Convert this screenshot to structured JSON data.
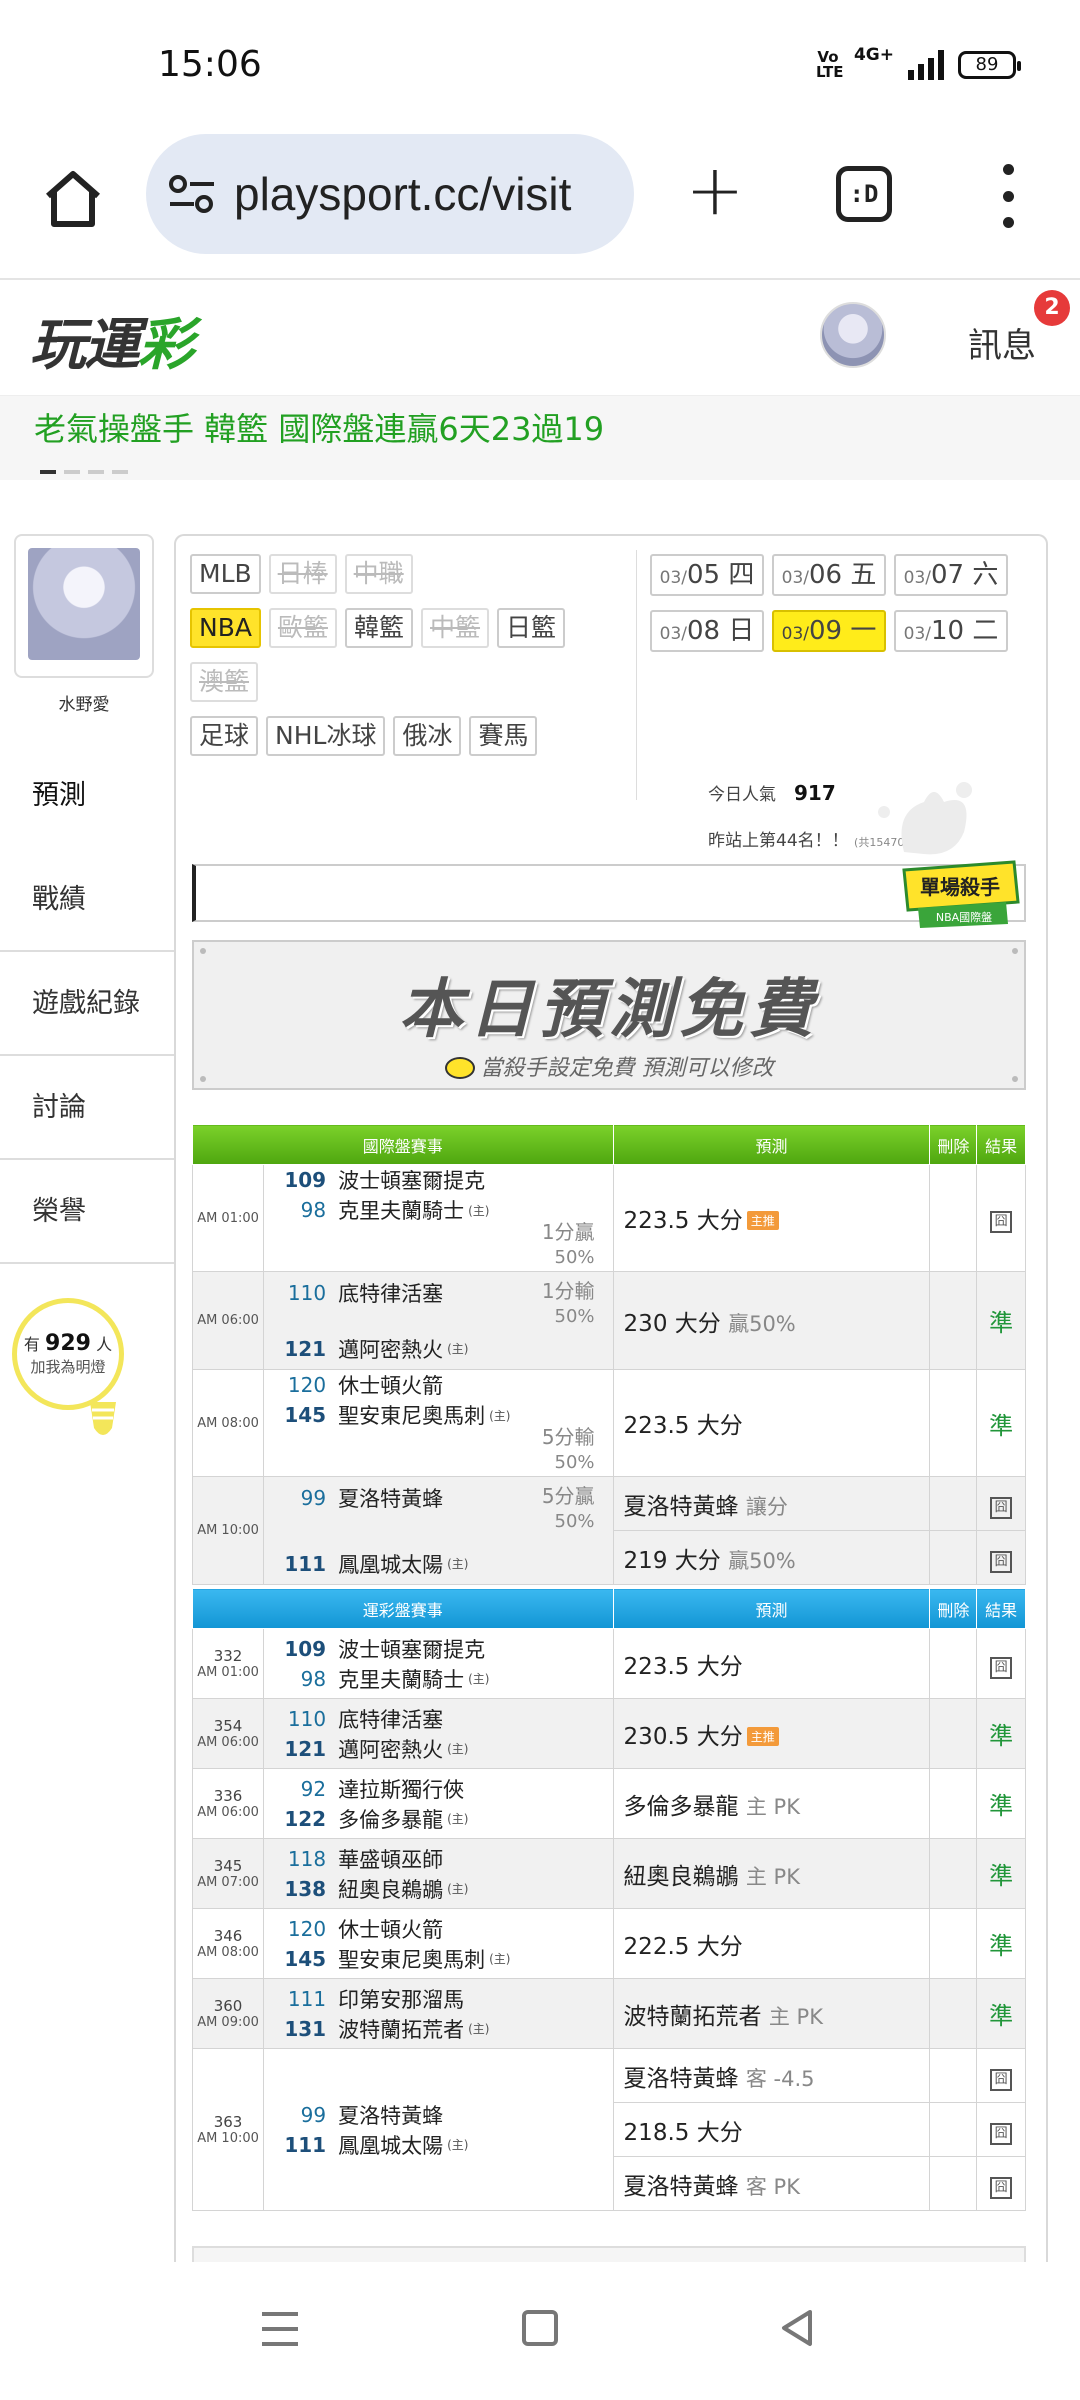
{
  "status": {
    "time": "15:06",
    "volte": "Vo\nLTE",
    "network": "4G+",
    "battery": "89"
  },
  "browser": {
    "url": "playsport.cc/visit",
    "tabs_label": ":D"
  },
  "header": {
    "logo_a": "玩運",
    "logo_b": "彩",
    "messages": "訊息",
    "messages_badge": "2"
  },
  "marquee": {
    "text": "老氣操盤手 韓籃 國際盤連贏6天23過19"
  },
  "profile": {
    "name": "水野愛"
  },
  "sidenav": [
    "預測",
    "戰績",
    "遊戲紀錄",
    "討論",
    "榮譽"
  ],
  "fans": {
    "prefix": "有",
    "count": "929",
    "suffix": "人",
    "cta": "加我為明燈"
  },
  "filters": {
    "row1": [
      {
        "label": "MLB",
        "state": "normal"
      },
      {
        "label": "日棒",
        "state": "disabled"
      },
      {
        "label": "中職",
        "state": "disabled"
      }
    ],
    "row2": [
      {
        "label": "NBA",
        "state": "selected"
      },
      {
        "label": "歐籃",
        "state": "disabled"
      },
      {
        "label": "韓籃",
        "state": "normal"
      },
      {
        "label": "中籃",
        "state": "disabled"
      },
      {
        "label": "日籃",
        "state": "normal"
      }
    ],
    "row3": [
      {
        "label": "澳籃",
        "state": "disabled"
      }
    ],
    "row4": [
      {
        "label": "足球",
        "state": "normal"
      },
      {
        "label": "NHL冰球",
        "state": "normal"
      },
      {
        "label": "俄冰",
        "state": "normal"
      },
      {
        "label": "賽馬",
        "state": "normal"
      }
    ]
  },
  "dates": [
    {
      "m": "03/",
      "d": "05 四",
      "sel": false
    },
    {
      "m": "03/",
      "d": "06 五",
      "sel": false
    },
    {
      "m": "03/",
      "d": "07 六",
      "sel": false
    },
    {
      "m": "03/",
      "d": "08 日",
      "sel": false
    },
    {
      "m": "03/",
      "d": "09 一",
      "sel": true
    },
    {
      "m": "03/",
      "d": "10 二",
      "sel": false
    }
  ],
  "popularity": {
    "label": "今日人氣",
    "value": "917",
    "rank": "昨站上第44名！！",
    "rank_note": "(共15470人)"
  },
  "badge": {
    "title": "單場殺手",
    "sub": "NBA國際盤"
  },
  "banner": {
    "title": "本日預測免費",
    "subtitle": "當殺手設定免費  預測可以修改"
  },
  "intl_table": {
    "headers": [
      "國際盤賽事",
      "預測",
      "刪除",
      "結果"
    ],
    "games": [
      {
        "time": "AM 01:00",
        "teams": [
          {
            "num": "109",
            "name": "波士頓塞爾提克",
            "host": false,
            "bold": true
          },
          {
            "num": "98",
            "name": "克里夫蘭騎士",
            "host": true,
            "bold": false
          }
        ],
        "spread": [
          "1分贏",
          "50%"
        ],
        "spread_pos": "bottom",
        "alt": false,
        "preds": [
          {
            "text": "223.5 大分",
            "sub": "",
            "tag": "主推",
            "result": "box"
          }
        ]
      },
      {
        "time": "AM 06:00",
        "teams": [
          {
            "num": "110",
            "name": "底特律活塞",
            "host": false,
            "bold": false
          },
          {
            "num": "121",
            "name": "邁阿密熱火",
            "host": true,
            "bold": true
          }
        ],
        "spread": [
          "1分輸",
          "50%"
        ],
        "spread_pos": "top",
        "alt": true,
        "preds": [
          {
            "text": "230 大分",
            "sub": "贏50%",
            "tag": "",
            "result": "準"
          }
        ]
      },
      {
        "time": "AM 08:00",
        "teams": [
          {
            "num": "120",
            "name": "休士頓火箭",
            "host": false,
            "bold": false
          },
          {
            "num": "145",
            "name": "聖安東尼奧馬刺",
            "host": true,
            "bold": true
          }
        ],
        "spread": [
          "5分輸",
          "50%"
        ],
        "spread_pos": "bottom",
        "alt": false,
        "preds": [
          {
            "text": "223.5 大分",
            "sub": "",
            "tag": "",
            "result": "準"
          }
        ]
      },
      {
        "time": "AM 10:00",
        "teams": [
          {
            "num": "99",
            "name": "夏洛特黃蜂",
            "host": false,
            "bold": false
          },
          {
            "num": "111",
            "name": "鳳凰城太陽",
            "host": true,
            "bold": true
          }
        ],
        "spread": [
          "5分贏",
          "50%"
        ],
        "spread_pos": "top",
        "alt": true,
        "preds": [
          {
            "text": "夏洛特黃蜂",
            "sub": "讓分",
            "tag": "",
            "result": "box"
          },
          {
            "text": "219 大分",
            "sub": "贏50%",
            "tag": "",
            "result": "box"
          }
        ]
      }
    ]
  },
  "lottery_table": {
    "headers": [
      "運彩盤賽事",
      "預測",
      "刪除",
      "結果"
    ],
    "games": [
      {
        "gid": "332",
        "time": "AM 01:00",
        "teams": [
          {
            "num": "109",
            "name": "波士頓塞爾提克",
            "host": false,
            "bold": true
          },
          {
            "num": "98",
            "name": "克里夫蘭騎士",
            "host": true,
            "bold": false
          }
        ],
        "alt": false,
        "preds": [
          {
            "text": "223.5 大分",
            "sub": "",
            "tag": "",
            "result": "box"
          }
        ]
      },
      {
        "gid": "354",
        "time": "AM 06:00",
        "teams": [
          {
            "num": "110",
            "name": "底特律活塞",
            "host": false,
            "bold": false
          },
          {
            "num": "121",
            "name": "邁阿密熱火",
            "host": true,
            "bold": true
          }
        ],
        "alt": true,
        "preds": [
          {
            "text": "230.5 大分",
            "sub": "",
            "tag": "主推",
            "result": "準"
          }
        ]
      },
      {
        "gid": "336",
        "time": "AM 06:00",
        "teams": [
          {
            "num": "92",
            "name": "達拉斯獨行俠",
            "host": false,
            "bold": false
          },
          {
            "num": "122",
            "name": "多倫多暴龍",
            "host": true,
            "bold": true
          }
        ],
        "alt": false,
        "preds": [
          {
            "text": "多倫多暴龍",
            "sub": "主 PK",
            "tag": "",
            "result": "準"
          }
        ]
      },
      {
        "gid": "345",
        "time": "AM 07:00",
        "teams": [
          {
            "num": "118",
            "name": "華盛頓巫師",
            "host": false,
            "bold": false
          },
          {
            "num": "138",
            "name": "紐奧良鵜鶘",
            "host": true,
            "bold": true
          }
        ],
        "alt": true,
        "preds": [
          {
            "text": "紐奧良鵜鶘",
            "sub": "主 PK",
            "tag": "",
            "result": "準"
          }
        ]
      },
      {
        "gid": "346",
        "time": "AM 08:00",
        "teams": [
          {
            "num": "120",
            "name": "休士頓火箭",
            "host": false,
            "bold": false
          },
          {
            "num": "145",
            "name": "聖安東尼奧馬刺",
            "host": true,
            "bold": true
          }
        ],
        "alt": false,
        "preds": [
          {
            "text": "222.5 大分",
            "sub": "",
            "tag": "",
            "result": "準"
          }
        ]
      },
      {
        "gid": "360",
        "time": "AM 09:00",
        "teams": [
          {
            "num": "111",
            "name": "印第安那溜馬",
            "host": false,
            "bold": false
          },
          {
            "num": "131",
            "name": "波特蘭拓荒者",
            "host": true,
            "bold": true
          }
        ],
        "alt": true,
        "preds": [
          {
            "text": "波特蘭拓荒者",
            "sub": "主 PK",
            "tag": "",
            "result": "準"
          }
        ]
      },
      {
        "gid": "363",
        "time": "AM 10:00",
        "teams": [
          {
            "num": "99",
            "name": "夏洛特黃蜂",
            "host": false,
            "bold": false
          },
          {
            "num": "111",
            "name": "鳳凰城太陽",
            "host": true,
            "bold": true
          }
        ],
        "alt": false,
        "preds": [
          {
            "text": "夏洛特黃蜂",
            "sub": "客 -4.5",
            "tag": "",
            "result": "box"
          },
          {
            "text": "218.5 大分",
            "sub": "",
            "tag": "",
            "result": "box"
          },
          {
            "text": "夏洛特黃蜂",
            "sub": "客 PK",
            "tag": "",
            "result": "box"
          }
        ]
      }
    ]
  },
  "host_mark": "(主)",
  "result_box_char": "囧"
}
